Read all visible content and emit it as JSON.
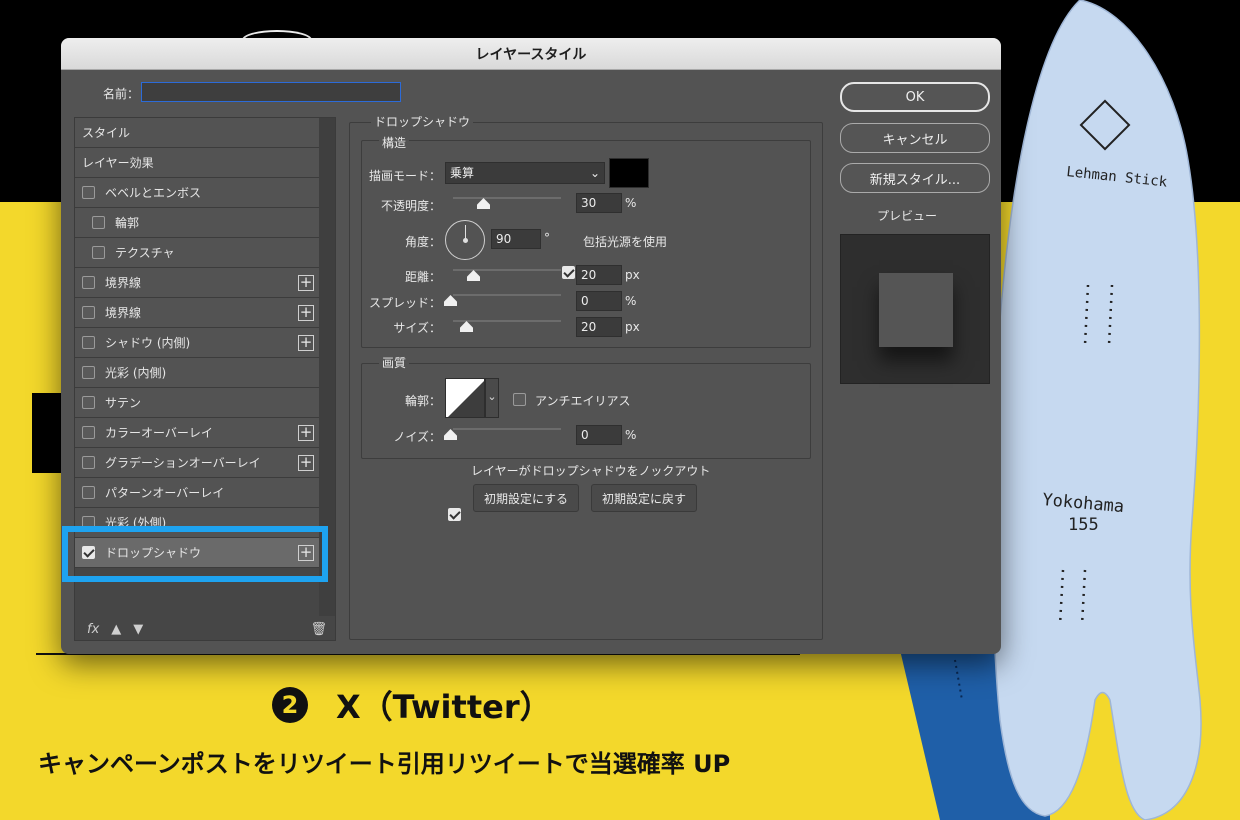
{
  "dialog": {
    "title": "レイヤースタイル",
    "name_label": "名前：",
    "name_value": ""
  },
  "styles": {
    "header_style": "スタイル",
    "header_effects": "レイヤー効果",
    "items": [
      {
        "label": "ベベルとエンボス",
        "checked": false,
        "indent": false,
        "plus": false
      },
      {
        "label": "輪郭",
        "checked": false,
        "indent": true,
        "plus": false
      },
      {
        "label": "テクスチャ",
        "checked": false,
        "indent": true,
        "plus": false
      },
      {
        "label": "境界線",
        "checked": false,
        "indent": false,
        "plus": true
      },
      {
        "label": "境界線",
        "checked": false,
        "indent": false,
        "plus": true
      },
      {
        "label": "シャドウ (内側)",
        "checked": false,
        "indent": false,
        "plus": true
      },
      {
        "label": "光彩 (内側)",
        "checked": false,
        "indent": false,
        "plus": false
      },
      {
        "label": "サテン",
        "checked": false,
        "indent": false,
        "plus": false
      },
      {
        "label": "カラーオーバーレイ",
        "checked": false,
        "indent": false,
        "plus": true
      },
      {
        "label": "グラデーションオーバーレイ",
        "checked": false,
        "indent": false,
        "plus": true
      },
      {
        "label": "パターンオーバーレイ",
        "checked": false,
        "indent": false,
        "plus": false
      },
      {
        "label": "光彩 (外側)",
        "checked": false,
        "indent": false,
        "plus": false
      },
      {
        "label": "ドロップシャドウ",
        "checked": true,
        "indent": false,
        "plus": true,
        "selected": true
      }
    ],
    "footer_fx": "fx",
    "highlight_color": "#1ea3f0"
  },
  "dropshadow": {
    "section_title": "ドロップシャドウ",
    "structure_title": "構造",
    "blend_mode_label": "描画モード：",
    "blend_mode_value": "乗算",
    "shadow_color": "#000000",
    "opacity_label": "不透明度：",
    "opacity_value": "30",
    "opacity_unit": "%",
    "opacity_pct": 30,
    "angle_label": "角度：",
    "angle_value": "90",
    "angle_unit": "°",
    "global_light_label": "包括光源を使用",
    "global_light_checked": true,
    "distance_label": "距離：",
    "distance_value": "20",
    "distance_unit": "px",
    "spread_label": "スプレッド：",
    "spread_value": "0",
    "spread_unit": "%",
    "size_label": "サイズ：",
    "size_value": "20",
    "size_unit": "px",
    "quality_title": "画質",
    "contour_label": "輪郭：",
    "antialias_label": "アンチエイリアス",
    "antialias_checked": false,
    "noise_label": "ノイズ：",
    "noise_value": "0",
    "noise_unit": "%",
    "knockout_label": "レイヤーがドロップシャドウをノックアウト",
    "knockout_checked": true,
    "make_default_label": "初期設定にする",
    "reset_default_label": "初期設定に戻す"
  },
  "actions": {
    "ok_label": "OK",
    "cancel_label": "キャンセル",
    "new_style_label": "新規スタイル...",
    "preview_label": "プレビュー",
    "preview_checked": true
  },
  "background": {
    "headline_num": "2",
    "headline_text": "X（Twitter）",
    "subline": "キャンペーンポストをリツイート引用リツイートで当選確率 UP",
    "board_brand": "Lehman Stick",
    "board_model": "Yokohama",
    "board_size": "155",
    "yellow": "#f3d82b"
  }
}
